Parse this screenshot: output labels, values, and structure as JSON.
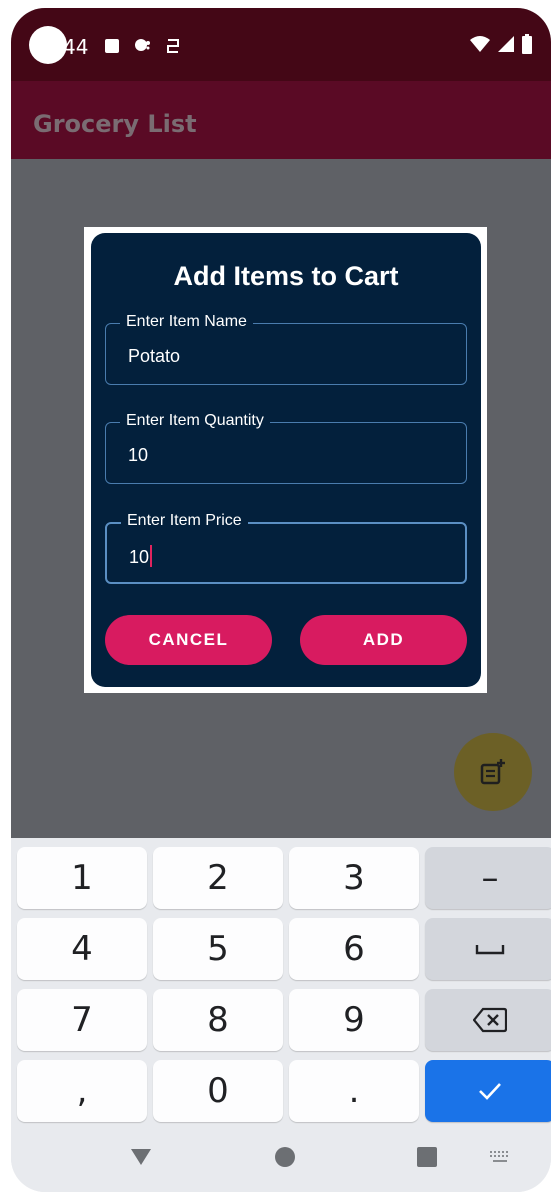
{
  "status_bar": {
    "time": "44"
  },
  "app_bar": {
    "title": "Grocery List"
  },
  "dialog": {
    "title": "Add Items to Cart",
    "fields": [
      {
        "label": "Enter Item Name",
        "value": "Potato"
      },
      {
        "label": "Enter Item Quantity",
        "value": "10"
      },
      {
        "label": "Enter Item Price",
        "value": "10"
      }
    ],
    "cancel_label": "CANCEL",
    "add_label": "ADD"
  },
  "keyboard": {
    "keys": [
      "1",
      "2",
      "3",
      "–",
      "4",
      "5",
      "6",
      "7",
      "8",
      "9",
      ",",
      "0",
      "."
    ]
  },
  "colors": {
    "status_bar": "#440716",
    "app_bar": "#5a0a25",
    "dialog_bg": "#03203c",
    "accent": "#d81b60",
    "field_border": "#4a7cae",
    "fab": "#6c6026",
    "enter_key": "#1a73e8"
  },
  "icons": {
    "status": [
      "camera-cutout",
      "a-icon",
      "notification-icon",
      "vpn-icon",
      "wifi-icon",
      "signal-icon",
      "battery-icon"
    ],
    "fab": "note-add-icon",
    "keyboard": [
      "space-icon",
      "backspace-icon",
      "check-icon"
    ],
    "nav": [
      "back-icon",
      "home-icon",
      "recents-icon",
      "keyboard-switch-icon"
    ]
  }
}
